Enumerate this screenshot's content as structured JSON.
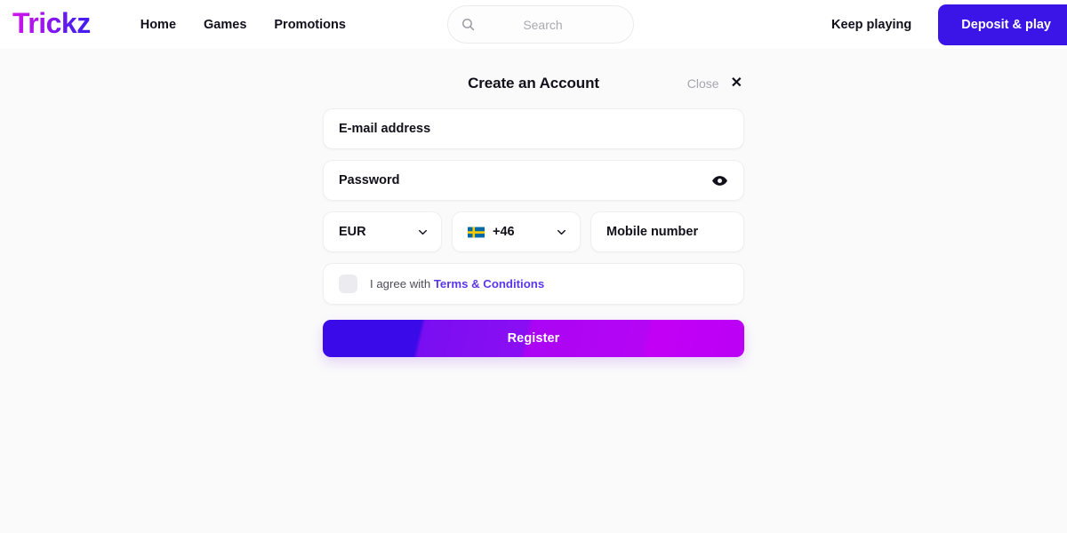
{
  "header": {
    "logo_text": "Trickz",
    "nav": [
      {
        "label": "Home"
      },
      {
        "label": "Games"
      },
      {
        "label": "Promotions"
      }
    ],
    "search": {
      "placeholder": "Search",
      "icon": "search-icon"
    },
    "keep_playing_label": "Keep playing",
    "deposit_label": "Deposit & play"
  },
  "modal": {
    "title": "Create an Account",
    "close_label": "Close",
    "close_icon": "✕",
    "fields": {
      "email": {
        "label": "E-mail address",
        "value": ""
      },
      "password": {
        "label": "Password",
        "value": "",
        "toggle_icon": "eye-icon"
      },
      "currency": {
        "value": "EUR",
        "chevron": "chevron-down-icon"
      },
      "dial_code": {
        "value": "+46",
        "flag": "sweden-flag-icon",
        "chevron": "chevron-down-icon"
      },
      "mobile": {
        "label": "Mobile number",
        "value": ""
      }
    },
    "terms": {
      "prefix": "I agree with ",
      "link_label": "Terms & Conditions",
      "checked": false
    },
    "submit_label": "Register"
  },
  "colors": {
    "page_background": "#fafafa",
    "header_background": "#ffffff",
    "brand_blue": "#3b14e8",
    "brand_magenta": "#bb00f5",
    "link_purple": "#5b36e8",
    "text_primary": "#12101a",
    "text_muted": "#a6a6af",
    "flag_blue": "#006aa7",
    "flag_yellow": "#fecc02"
  }
}
